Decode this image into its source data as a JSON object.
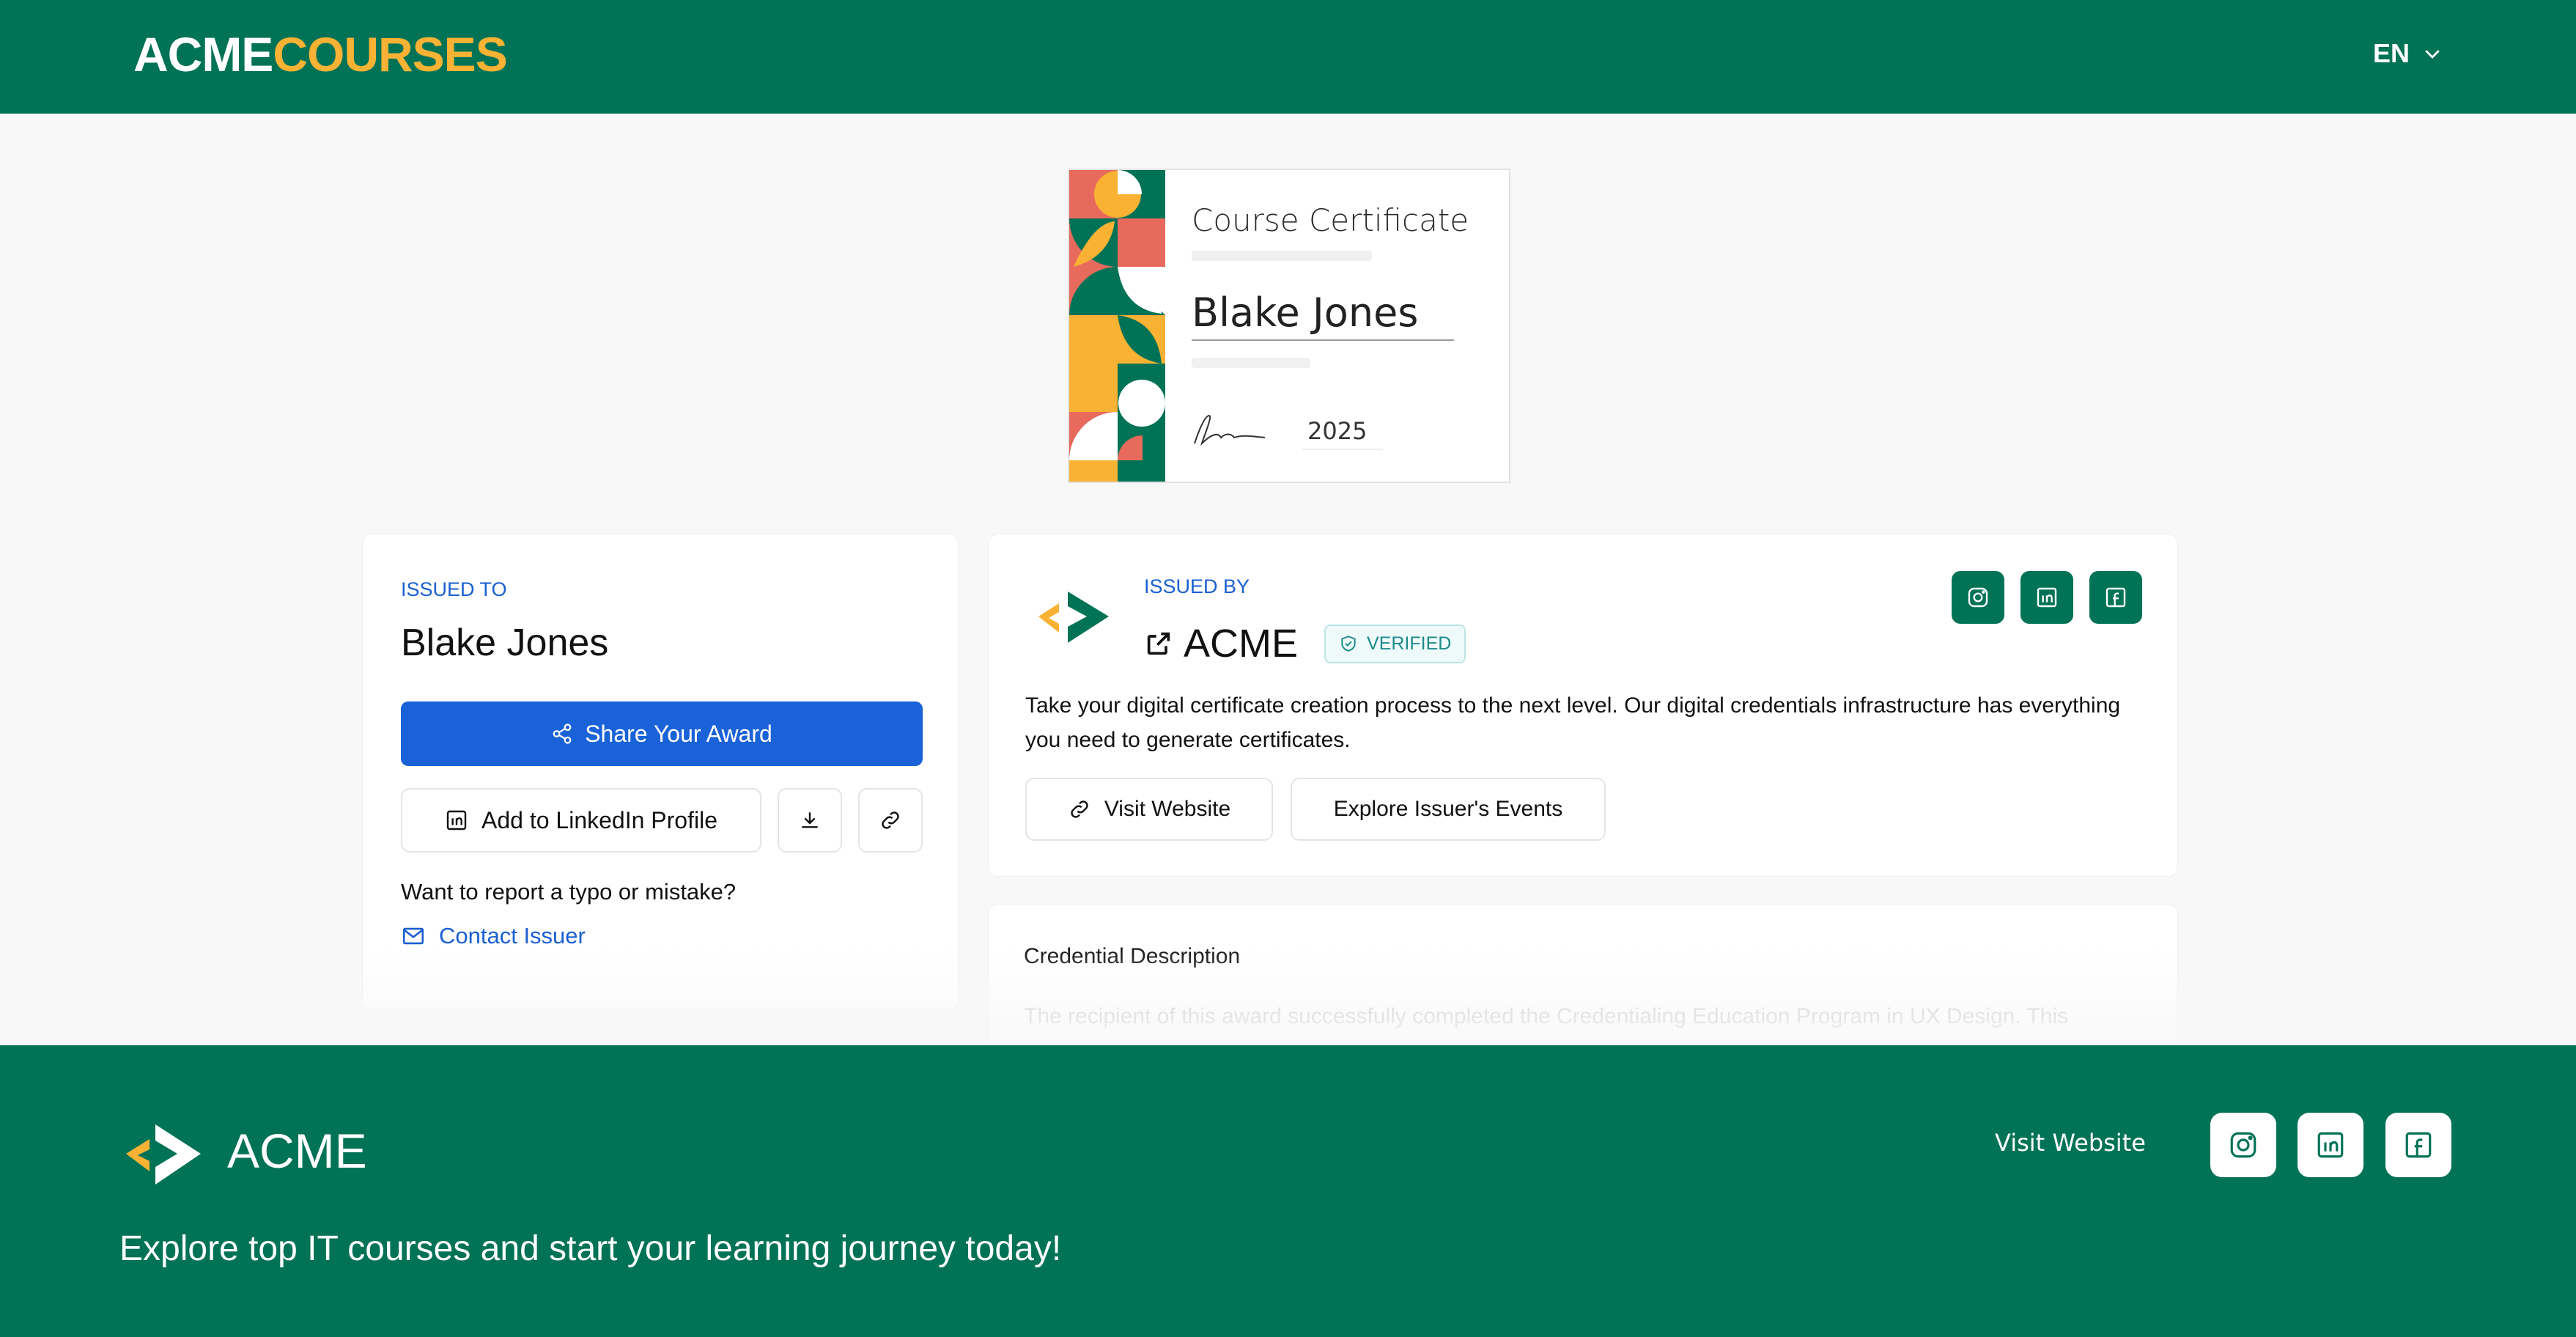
{
  "header": {
    "logo_part1": "ACME",
    "logo_part2": "COURSES",
    "language": "EN"
  },
  "certificate": {
    "title": "Course Certificate",
    "recipient": "Blake Jones",
    "year": "2025"
  },
  "recipient_card": {
    "issued_to_label": "ISSUED TO",
    "name": "Blake Jones",
    "share_label": "Share Your Award",
    "linkedin_label": "Add to LinkedIn Profile",
    "report_text": "Want to report a typo or mistake?",
    "contact_label": "Contact Issuer"
  },
  "issuer_card": {
    "issued_by_label": "ISSUED BY",
    "name": "ACME",
    "verified_label": "VERIFIED",
    "description": "Take your digital certificate creation process to the next level. Our digital credentials infrastructure has everything you need to generate certificates.",
    "visit_label": "Visit Website",
    "events_label": "Explore Issuer's Events"
  },
  "description_card": {
    "title": "Credential Description",
    "text": "The recipient of this award successfully completed the Credentialing Education Program in UX Design. This"
  },
  "footer": {
    "brand": "ACME",
    "tagline": "Explore top IT courses and start your learning journey today!",
    "visit_label": "Visit Website"
  },
  "icons": {
    "social": [
      "instagram-icon",
      "linkedin-icon",
      "facebook-icon"
    ]
  },
  "colors": {
    "brand_green": "#007256",
    "brand_orange": "#f9b233",
    "primary_blue": "#1962d8",
    "verified_teal": "#1d8a8a"
  }
}
